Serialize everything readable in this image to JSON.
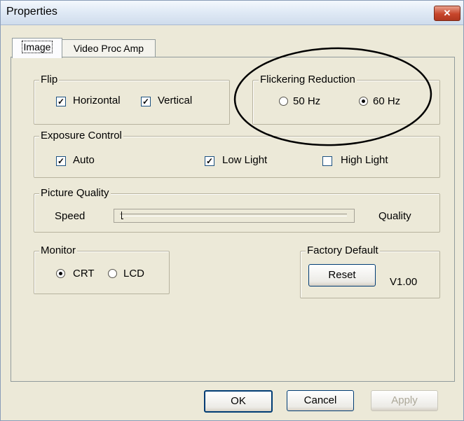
{
  "window": {
    "title": "Properties",
    "close_glyph": "✕"
  },
  "tabs": [
    {
      "label": "Image",
      "active": true
    },
    {
      "label": "Video Proc Amp",
      "active": false
    }
  ],
  "flip": {
    "legend": "Flip",
    "horizontal": {
      "label": "Horizontal",
      "checked": true
    },
    "vertical": {
      "label": "Vertical",
      "checked": true
    }
  },
  "flicker": {
    "legend": "Flickering Reduction",
    "hz50": {
      "label": "50 Hz",
      "selected": false
    },
    "hz60": {
      "label": "60 Hz",
      "selected": true
    }
  },
  "exposure": {
    "legend": "Exposure Control",
    "auto": {
      "label": "Auto",
      "checked": true
    },
    "low_light": {
      "label": "Low Light",
      "checked": true
    },
    "high_light": {
      "label": "High Light",
      "checked": false
    }
  },
  "quality": {
    "legend": "Picture Quality",
    "left_label": "Speed",
    "right_label": "Quality",
    "slider_value": 0
  },
  "monitor": {
    "legend": "Monitor",
    "crt": {
      "label": "CRT",
      "selected": true
    },
    "lcd": {
      "label": "LCD",
      "selected": false
    }
  },
  "factory": {
    "legend": "Factory Default",
    "reset_label": "Reset",
    "version": "V1.00"
  },
  "buttons": {
    "ok": "OK",
    "cancel": "Cancel",
    "apply": "Apply"
  },
  "check_glyph": "✓",
  "colors": {
    "annotation_ellipse": "#000000",
    "face": "#ece9d8"
  }
}
